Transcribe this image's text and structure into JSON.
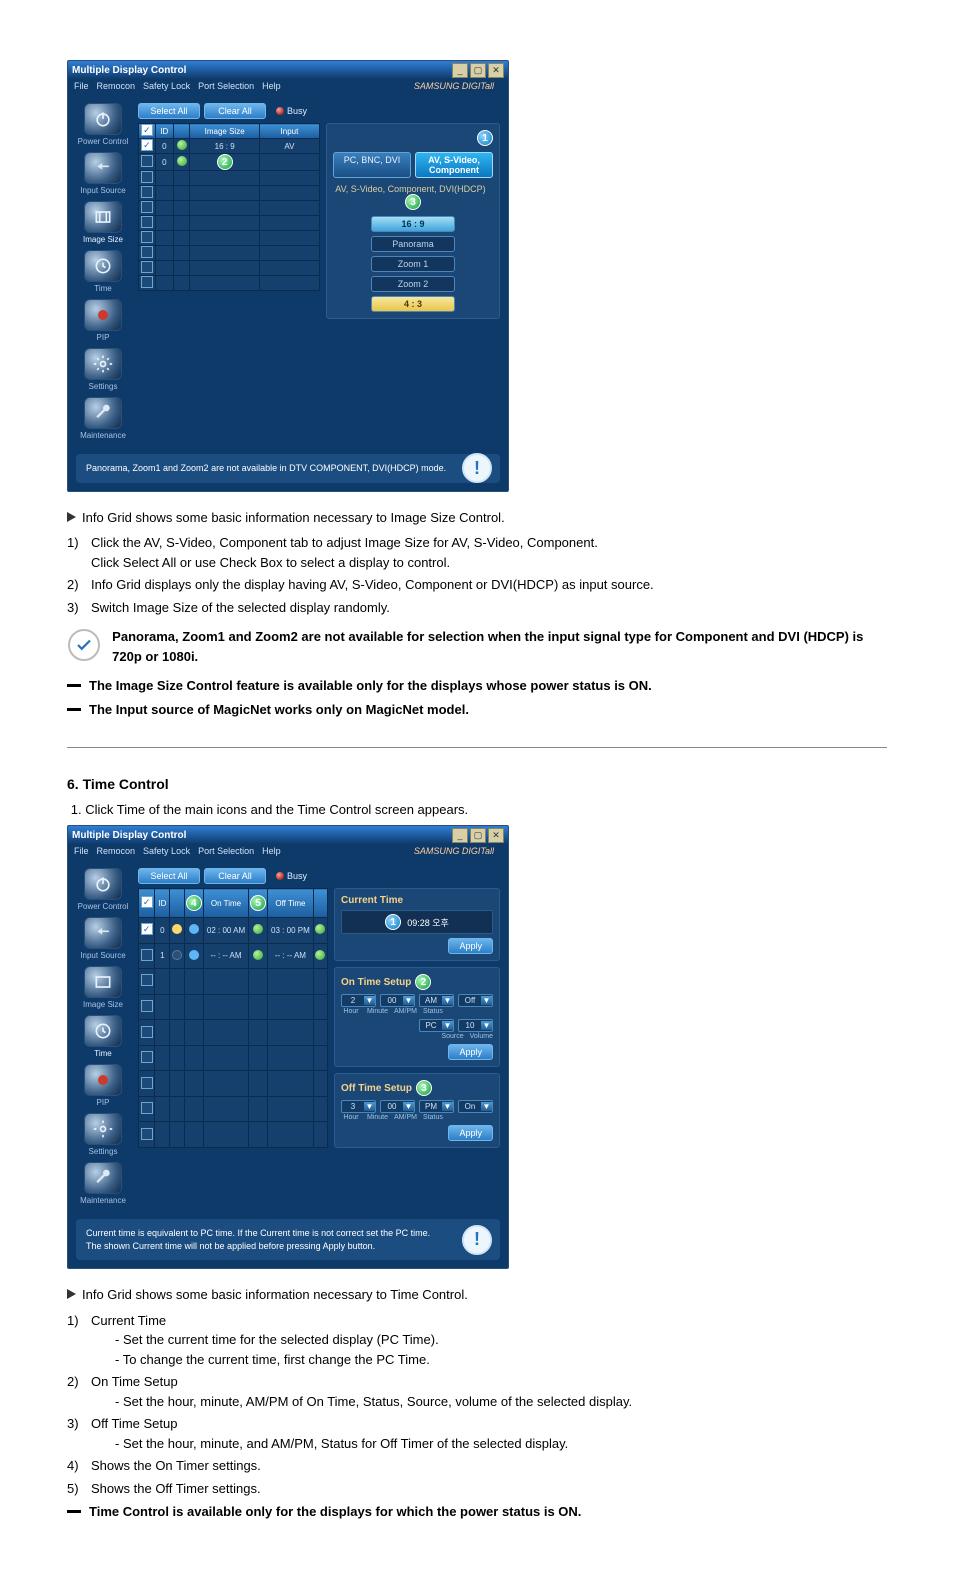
{
  "app": {
    "title": "Multiple Display Control",
    "brand": "SAMSUNG DIGITall",
    "menu": [
      "File",
      "Remocon",
      "Safety Lock",
      "Port Selection",
      "Help"
    ],
    "toolbar": {
      "select_all": "Select All",
      "clear_all": "Clear All",
      "busy": "Busy"
    }
  },
  "sidebar": {
    "items": [
      {
        "label": "Power Control"
      },
      {
        "label": "Input Source"
      },
      {
        "label": "Image Size"
      },
      {
        "label": "Time"
      },
      {
        "label": "PIP"
      },
      {
        "label": "Settings"
      },
      {
        "label": "Maintenance"
      }
    ]
  },
  "imagesize": {
    "grid": {
      "headers": [
        "",
        "ID",
        "",
        "Image Size",
        "Input"
      ],
      "rows": [
        {
          "chk": true,
          "id": "0",
          "green": true,
          "size": "16 : 9",
          "input": "AV"
        },
        {
          "chk": false,
          "id": "0",
          "green": true,
          "size": "",
          "input": ""
        },
        {
          "chk": false,
          "id": "",
          "green": false,
          "size": "",
          "input": ""
        },
        {
          "chk": false,
          "id": "",
          "green": false
        },
        {
          "chk": false,
          "id": "",
          "green": false
        },
        {
          "chk": false,
          "id": "",
          "green": false
        },
        {
          "chk": false,
          "id": "",
          "green": false
        },
        {
          "chk": false,
          "id": "",
          "green": false
        },
        {
          "chk": false,
          "id": "",
          "green": false
        },
        {
          "chk": false,
          "id": "",
          "green": false
        }
      ],
      "badge2_title": "2"
    },
    "tabs": {
      "left": "PC, BNC, DVI",
      "right": "AV, S-Video, Component"
    },
    "subtitle": "AV, S-Video, Component, DVI(HDCP)",
    "badge1": "1",
    "badge3": "3",
    "options": [
      "16 : 9",
      "Panorama",
      "Zoom 1",
      "Zoom 2",
      "4 : 3"
    ],
    "info": "Panorama, Zoom1 and Zoom2 are not available in DTV COMPONENT, DVI(HDCP) mode."
  },
  "notes_imagesize": {
    "lead": "Info Grid shows some basic information necessary to Image Size Control.",
    "items": [
      "Click the AV, S-Video, Component tab to adjust Image Size for AV, S-Video, Component.",
      "Info Grid displays only the display having AV, S-Video, Component or DVI(HDCP) as input source.",
      "Switch Image Size of the selected display randomly."
    ],
    "sub1": "Click Select All or use Check Box to select a display to control.",
    "callout": "Panorama, Zoom1 and Zoom2 are not available for selection when the input signal type for Component and DVI (HDCP) is 720p or 1080i.",
    "dash1": "The Image Size Control feature is available only for the displays whose power status is ON.",
    "dash2": "The Input source of MagicNet works only on MagicNet model."
  },
  "sect6": {
    "title": "6. Time Control",
    "step1": "Click Time of the main icons and the Time Control screen appears."
  },
  "time": {
    "grid": {
      "headers": [
        "",
        "ID",
        "",
        "",
        "On Time",
        "",
        "Off Time",
        ""
      ],
      "badge4": "4",
      "badge5": "5",
      "rows": [
        {
          "chk": true,
          "id": "0",
          "y": true,
          "b": true,
          "on": "02 : 00 AM",
          "off": "03 : 00 PM",
          "g1": true,
          "g2": true
        },
        {
          "chk": false,
          "id": "1",
          "y": false,
          "b": true,
          "on": "-- : -- AM",
          "off": "-- : -- AM",
          "g1": true,
          "g2": true
        },
        {
          "chk": false
        },
        {
          "chk": false
        },
        {
          "chk": false
        },
        {
          "chk": false
        },
        {
          "chk": false
        },
        {
          "chk": false
        },
        {
          "chk": false
        }
      ]
    },
    "current": {
      "title": "Current Time",
      "badge": "1",
      "value": "09:28 오후",
      "apply": "Apply"
    },
    "on_setup": {
      "title": "On Time Setup",
      "badge": "2",
      "hour": "2",
      "min": "00",
      "ampm": "AM",
      "status": "Off",
      "source": "PC",
      "volume": "10",
      "labels": [
        "Hour",
        "Minute",
        "AM/PM",
        "Status",
        "Source",
        "Volume"
      ],
      "apply": "Apply"
    },
    "off_setup": {
      "title": "Off Time Setup",
      "badge": "3",
      "hour": "3",
      "min": "00",
      "ampm": "PM",
      "status": "On",
      "labels": [
        "Hour",
        "Minute",
        "AM/PM",
        "Status"
      ],
      "apply": "Apply"
    },
    "info1": "Current time is equivalent to PC time. If the Current time is not correct set the PC time.",
    "info2": "The shown Current time will not be applied before pressing Apply button."
  },
  "notes_time": {
    "lead": "Info Grid shows some basic information necessary to Time Control.",
    "items": [
      "Current Time",
      "On Time Setup",
      "Off Time Setup",
      "Shows the On Timer settings.",
      "Shows the Off Timer settings."
    ],
    "sub1a": "- Set the current time for the selected display (PC Time).",
    "sub1b": "- To change the current time, first change the PC Time.",
    "sub2": "- Set the hour, minute, AM/PM of On Time, Status, Source, volume of the selected display.",
    "sub3": "- Set the hour, minute, and AM/PM, Status for Off Timer of the selected display.",
    "dash": "Time Control is available only for the displays for which the power status is ON."
  }
}
